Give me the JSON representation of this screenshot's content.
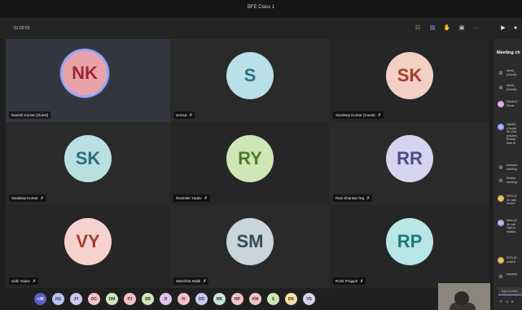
{
  "window": {
    "title": "BFE Class 1"
  },
  "call": {
    "timer": "01:02:53"
  },
  "participants": [
    {
      "initials": "NK",
      "name": "Naresh Kumar (Guest)",
      "bg": "#e9a3a8",
      "fg": "#9a2730",
      "muted": false
    },
    {
      "initials": "S",
      "name": "semsa",
      "bg": "#b9dfe8",
      "fg": "#2c7285",
      "muted": true
    },
    {
      "initials": "SK",
      "name": "Sandeep Kumar (Guest)",
      "bg": "#f3cfc6",
      "fg": "#a3402e",
      "muted": true
    },
    {
      "initials": "SK",
      "name": "Sandeep Kumar",
      "bg": "#b9dfe3",
      "fg": "#2d6e7c",
      "muted": true
    },
    {
      "initials": "RY",
      "name": "Ravinder Yadav",
      "bg": "#cfe7b6",
      "fg": "#4e7a2a",
      "muted": true
    },
    {
      "initials": "RR",
      "name": "Ravi Shankar Raj",
      "bg": "#d6d3ee",
      "fg": "#4d4989",
      "muted": true
    },
    {
      "initials": "VY",
      "name": "vidhi Yadav",
      "bg": "#f6d2ce",
      "fg": "#a3402e",
      "muted": true
    },
    {
      "initials": "SM",
      "name": "Swechha Malik",
      "bg": "#c8d5dd",
      "fg": "#334a57",
      "muted": true
    },
    {
      "initials": "RP",
      "name": "Rohit Prajapti",
      "bg": "#b9e6e6",
      "fg": "#1f7a7a",
      "muted": true
    }
  ],
  "overflow_strip": [
    {
      "initials": "+36",
      "bg": "#5b5fc7"
    },
    {
      "initials": "NS",
      "bg": "#b9c2f2"
    },
    {
      "initials": "JY",
      "bg": "#cfc7f0"
    },
    {
      "initials": "DC",
      "bg": "#f4c3c9"
    },
    {
      "initials": "DM",
      "bg": "#cfe7c1"
    },
    {
      "initials": "PJ",
      "bg": "#f6c1c6"
    },
    {
      "initials": "SB",
      "bg": "#cfe7b6"
    },
    {
      "initials": "D",
      "bg": "#e2c4ee"
    },
    {
      "initials": "IV",
      "bg": "#f4c3c9"
    },
    {
      "initials": "DD",
      "bg": "#c6ccf0"
    },
    {
      "initials": "MK",
      "bg": "#c9e4da"
    },
    {
      "initials": "RP",
      "bg": "#f6c1c6"
    },
    {
      "initials": "KM",
      "bg": "#f6c1c6"
    },
    {
      "initials": "S",
      "bg": "#cfe7b6"
    },
    {
      "initials": "DK",
      "bg": "#f3e0a6"
    },
    {
      "initials": "VS",
      "bg": "#d6d3ee"
    }
  ],
  "chat": {
    "title": "Meeting ch",
    "messages": [
      {
        "icon": "sys",
        "text": "Mohit_\n(Guest)"
      },
      {
        "icon": "sys",
        "text": "Mohit_\n(Guest)"
      },
      {
        "icon": "KK",
        "icon_bg": "#d6a3e3",
        "text": "Kavita K\nOk sir"
      },
      {
        "icon": "NK",
        "icon_bg": "#8fa2ff",
        "text": "NAVEE\n(Guest)\nSir char\npractica\nfinding\nthan th"
      },
      {
        "icon": "sys",
        "text": "prakash\nmeeting"
      },
      {
        "icon": "sys",
        "text": "Radha\nmeeting"
      },
      {
        "icon": "RY",
        "icon_bg": "#e0b54f",
        "text": "RITA (G\nsir, whe\nexam?"
      },
      {
        "icon": "MG",
        "icon_bg": "#b99ce6",
        "text": "Mihir (G\nSir can\nlogin a\nrelated"
      },
      {
        "icon": "RY",
        "icon_bg": "#e0b54f",
        "text": "RITA (G\nwhat is"
      },
      {
        "icon": "sys",
        "text": "sunaina"
      }
    ],
    "input_placeholder": "Type a new"
  }
}
